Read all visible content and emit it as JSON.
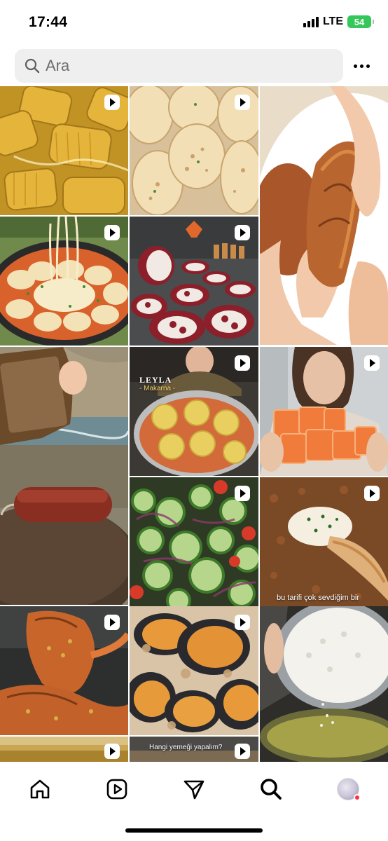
{
  "status_bar": {
    "time": "17:44",
    "network": "LTE",
    "battery": "54"
  },
  "search": {
    "placeholder": "Ara"
  },
  "grid": {
    "tiles": [
      {
        "id": "corn",
        "is_reel": true
      },
      {
        "id": "flatbread",
        "is_reel": true
      },
      {
        "id": "potato-roll",
        "is_reel": false
      },
      {
        "id": "cheese-ring",
        "is_reel": true
      },
      {
        "id": "sausage-rolls",
        "is_reel": true
      },
      {
        "id": "sucuk-outdoor",
        "is_reel": false
      },
      {
        "id": "leyla-makarna",
        "is_reel": true,
        "title": "LEYLA",
        "subtitle": "- Makarna -"
      },
      {
        "id": "salmon-hand",
        "is_reel": true
      },
      {
        "id": "cucumber-salad",
        "is_reel": true
      },
      {
        "id": "lahmacun",
        "is_reel": true,
        "caption": "bu tarifi çok sevdiğim bir"
      },
      {
        "id": "lobster",
        "is_reel": true
      },
      {
        "id": "stuffed-mussels",
        "is_reel": true
      },
      {
        "id": "onion-fry",
        "is_reel": false
      },
      {
        "id": "bottom-1",
        "is_reel": true
      },
      {
        "id": "bottom-2",
        "is_reel": true,
        "caption": "Hangi yemeği yapalım?"
      },
      {
        "id": "bottom-3",
        "is_reel": false
      }
    ]
  },
  "bottom_nav": {
    "items": [
      {
        "icon": "home-icon"
      },
      {
        "icon": "reels-icon"
      },
      {
        "icon": "send-icon"
      },
      {
        "icon": "search-icon",
        "active": true
      },
      {
        "icon": "profile-avatar"
      }
    ]
  }
}
